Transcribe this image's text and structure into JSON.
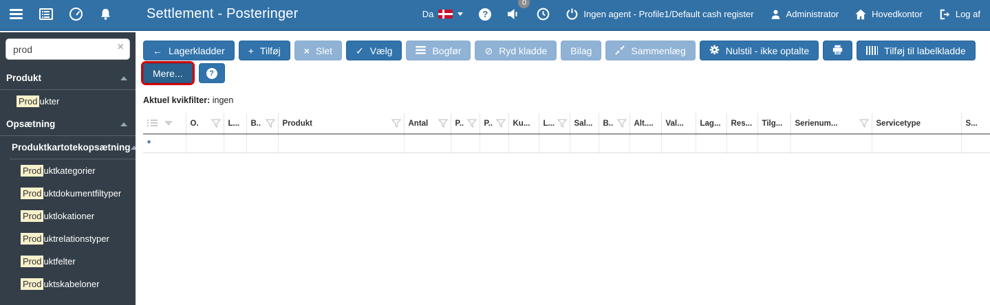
{
  "topbar": {
    "title": "Settlement - Posteringer",
    "language_label": "Da",
    "badge_count": "0",
    "agent_text": "Ingen agent - Profile1/Default cash register",
    "user_label": "Administrator",
    "site_label": "Hovedkontor",
    "logout_label": "Log af",
    "colors": {
      "bar": "#3271A6",
      "bar_border": "#2A6096"
    }
  },
  "sidebar": {
    "search_value": "prod",
    "section_produkt": "Produkt",
    "section_opsaetning": "Opsætning",
    "subsection_label": "Produktkartotekopsætning",
    "items": [
      {
        "hl": "Prod",
        "rest": "ukter"
      },
      {
        "hl": "Prod",
        "rest": "uktkategorier"
      },
      {
        "hl": "Prod",
        "rest": "uktdokumentfiltyper"
      },
      {
        "hl": "Prod",
        "rest": "uktlokationer"
      },
      {
        "hl": "Prod",
        "rest": "uktrelationstyper"
      },
      {
        "hl": "Prod",
        "rest": "uktfelter"
      },
      {
        "hl": "Prod",
        "rest": "uktskabeloner"
      }
    ],
    "colors": {
      "bg": "#333E48",
      "highlight": "#F7F1CB"
    }
  },
  "toolbar": {
    "buttons": [
      {
        "label": "Lagerkladder",
        "enabled": true,
        "icon": "arrow-left"
      },
      {
        "label": "Tilføj",
        "enabled": true,
        "icon": "plus"
      },
      {
        "label": "Slet",
        "enabled": false,
        "icon": "x"
      },
      {
        "label": "Vælg",
        "enabled": true,
        "icon": "check"
      },
      {
        "label": "Bogfør",
        "enabled": false,
        "icon": "list-lines"
      },
      {
        "label": "Ryd kladde",
        "enabled": false,
        "icon": "ban"
      },
      {
        "label": "Bilag",
        "enabled": false,
        "icon": "none"
      },
      {
        "label": "Sammenlæg",
        "enabled": false,
        "icon": "compress"
      },
      {
        "label": "Nulstil - ikke optalte",
        "enabled": true,
        "icon": "gear"
      },
      {
        "label": "",
        "enabled": true,
        "icon": "printer"
      },
      {
        "label": "Tilføj til labelkladde",
        "enabled": true,
        "icon": "barcode"
      }
    ],
    "more_label": "Mere...",
    "quickfilter_label": "Aktuel kvikfilter:",
    "quickfilter_value": "ingen",
    "colors": {
      "enabled": "#3273AB",
      "disabled": "#8FB2D5",
      "annotation": "#D40000"
    }
  },
  "table": {
    "columns": [
      {
        "label": "",
        "filter": false
      },
      {
        "label": "O.",
        "filter": true
      },
      {
        "label": "L...",
        "filter": false
      },
      {
        "label": "B..",
        "filter": true
      },
      {
        "label": "Produkt",
        "filter": true
      },
      {
        "label": "Antal",
        "filter": true
      },
      {
        "label": "P..",
        "filter": true
      },
      {
        "label": "P..",
        "filter": true
      },
      {
        "label": "Ku...",
        "filter": false
      },
      {
        "label": "L...",
        "filter": true
      },
      {
        "label": "Sal...",
        "filter": false
      },
      {
        "label": "B..",
        "filter": true
      },
      {
        "label": "Alt....",
        "filter": false
      },
      {
        "label": "Val...",
        "filter": false
      },
      {
        "label": "Lag...",
        "filter": false
      },
      {
        "label": "Res...",
        "filter": false
      },
      {
        "label": "Tilg...",
        "filter": false
      },
      {
        "label": "Serienum...",
        "filter": true
      },
      {
        "label": "Servicetype",
        "filter": false
      },
      {
        "label": "S...",
        "filter": false
      }
    ],
    "row_marker": "*"
  }
}
